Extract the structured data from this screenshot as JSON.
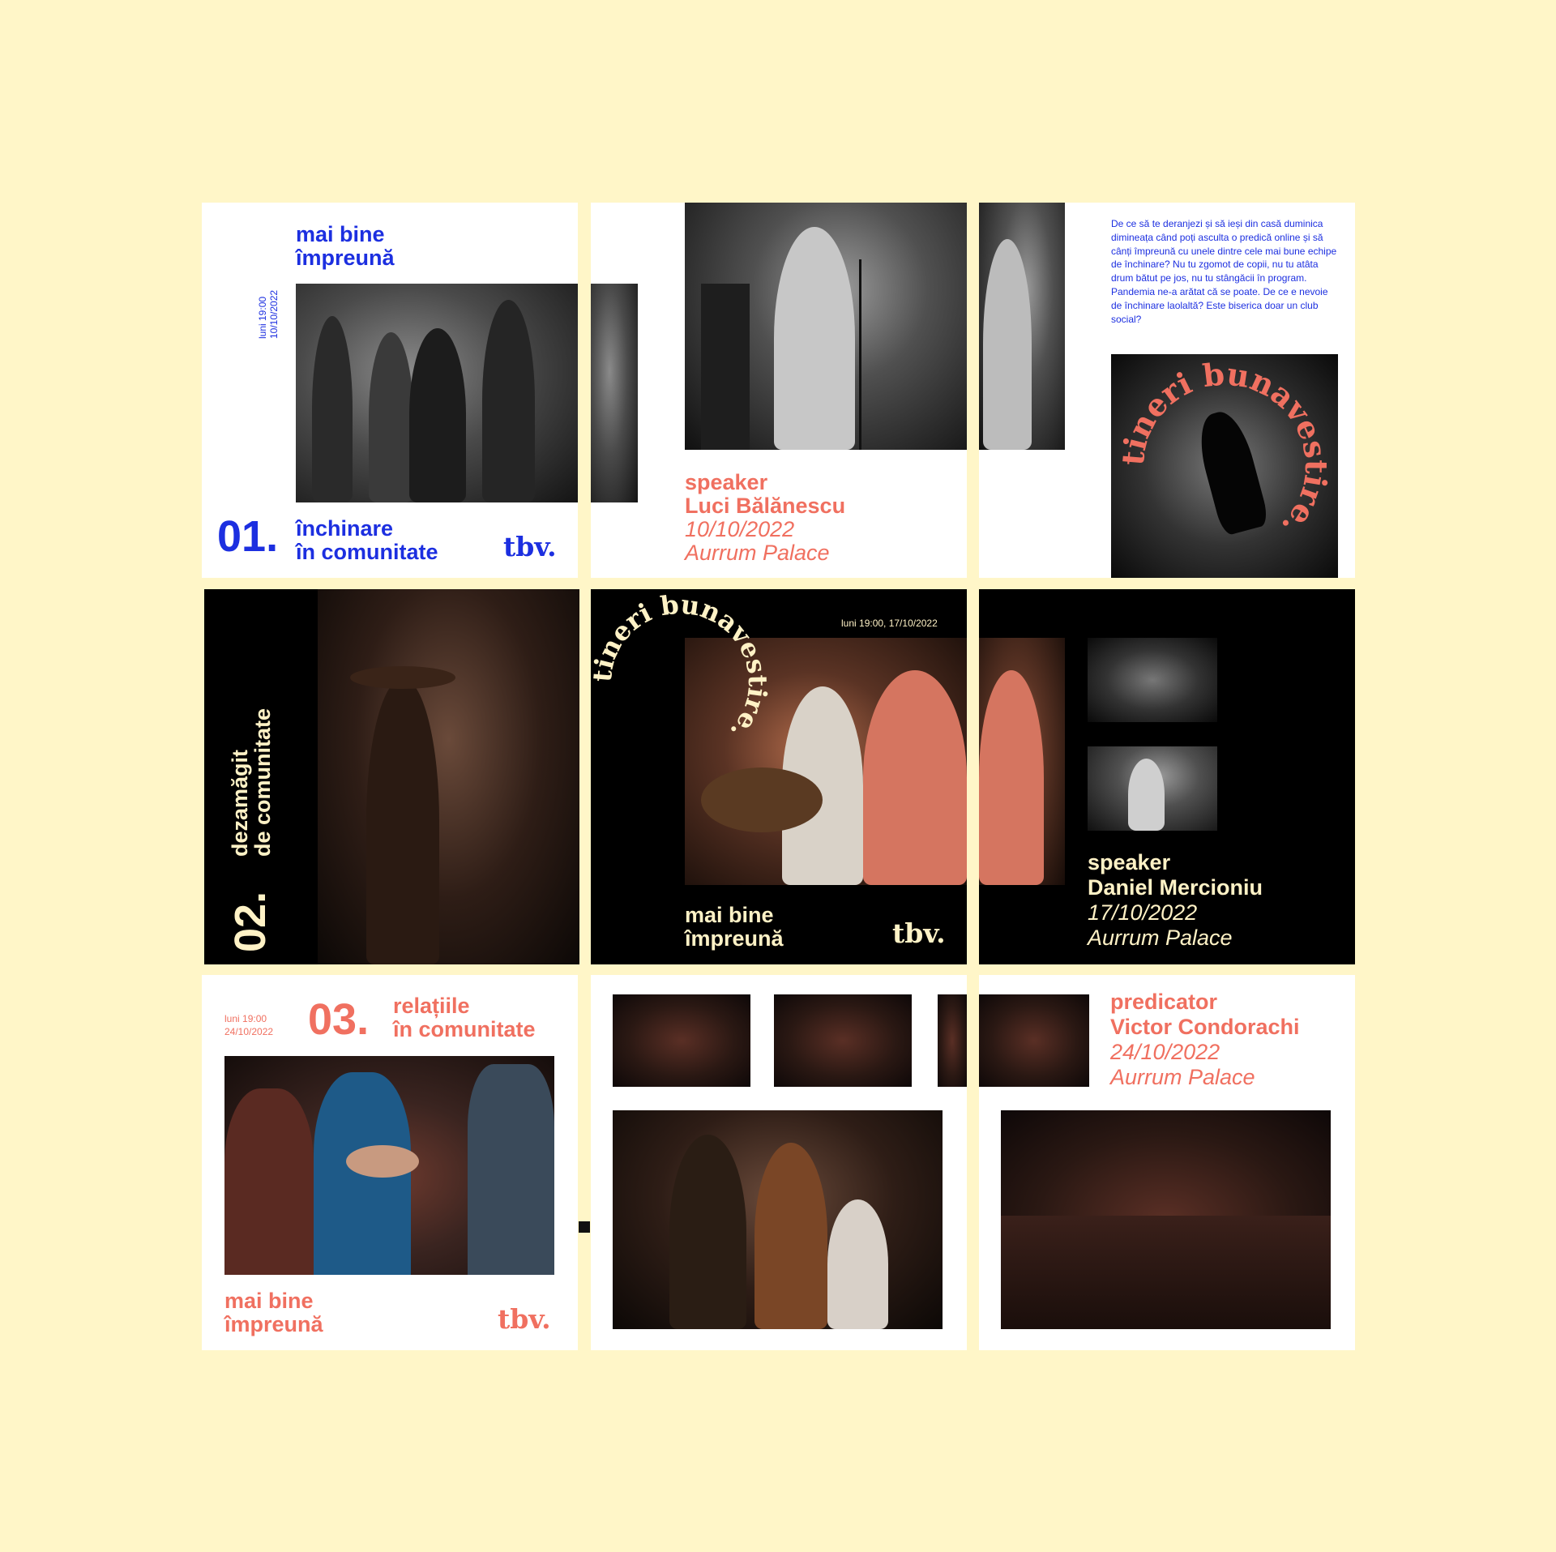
{
  "tile_1": {
    "title_line1": "mai bine",
    "title_line2": "împreună",
    "date_line1": "luni 19:00",
    "date_line2": "10/10/2022",
    "number": "01.",
    "topic_line1": "închinare",
    "topic_line2": "în comunitate",
    "logo": "tbv."
  },
  "tile_2": {
    "role": "speaker",
    "name": "Luci Bălănescu",
    "date": "10/10/2022",
    "venue": "Aurrum Palace"
  },
  "tile_3": {
    "paragraph": "De ce să te deranjezi și să ieși din casă duminica dimineața când poți asculta o predică online și să cânți împreună cu unele dintre cele mai bune echipe de închinare? Nu tu zgomot de copii, nu tu atâta drum bătut pe jos, nu tu stângăcii în program. Pandemia ne-a arătat că se poate. De ce e nevoie de închinare laolaltă? Este biserica doar un club social?",
    "circle_text": "tineri bunavestire."
  },
  "tile_4": {
    "number": "02.",
    "topic_line1": "dezamăgit",
    "topic_line2": "de comunitate"
  },
  "tile_5": {
    "circle_text": "tineri bunavestire.",
    "date": "luni 19:00, 17/10/2022",
    "title_line1": "mai bine",
    "title_line2": "împreună",
    "logo": "tbv."
  },
  "tile_6": {
    "role": "speaker",
    "name": "Daniel Mercioniu",
    "date": "17/10/2022",
    "venue": "Aurrum Palace"
  },
  "tile_7": {
    "date_line1": "luni 19:00",
    "date_line2": "24/10/2022",
    "number": "03.",
    "topic_line1": "relațiile",
    "topic_line2": "în comunitate",
    "title_line1": "mai bine",
    "title_line2": "împreună",
    "logo": "tbv."
  },
  "tile_9": {
    "role": "predicator",
    "name": "Victor Condorachi",
    "date": "24/10/2022",
    "venue": "Aurrum Palace"
  },
  "colors": {
    "background": "#fff6c8",
    "blue": "#1c2fe0",
    "coral": "#f07060",
    "cream": "#fff2c6"
  }
}
